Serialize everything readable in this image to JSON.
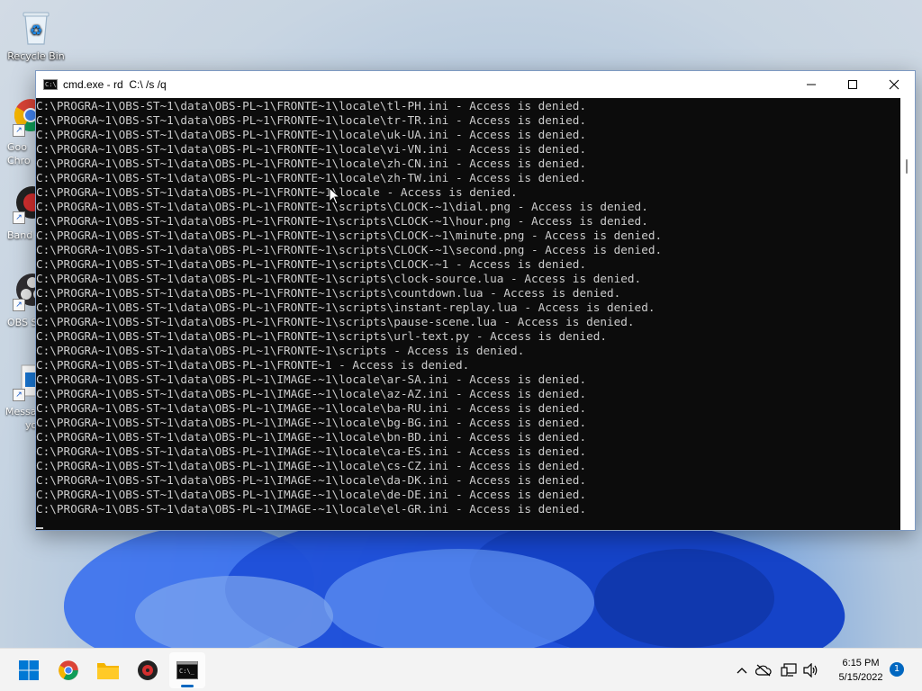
{
  "desktop": {
    "icons": [
      {
        "label": "Recycle Bin"
      }
    ],
    "partial_labels": [
      "Goo",
      "Chro",
      "Band",
      "OBS S",
      "Messa",
      "yo"
    ]
  },
  "window": {
    "title": "cmd.exe - rd  C:\\ /s /q",
    "minimize_icon": "minimize-icon",
    "maximize_icon": "maximize-icon",
    "close_icon": "close-icon",
    "console_lines": [
      "C:\\PROGRA~1\\OBS-ST~1\\data\\OBS-PL~1\\FRONTE~1\\locale\\tl-PH.ini - Access is denied.",
      "C:\\PROGRA~1\\OBS-ST~1\\data\\OBS-PL~1\\FRONTE~1\\locale\\tr-TR.ini - Access is denied.",
      "C:\\PROGRA~1\\OBS-ST~1\\data\\OBS-PL~1\\FRONTE~1\\locale\\uk-UA.ini - Access is denied.",
      "C:\\PROGRA~1\\OBS-ST~1\\data\\OBS-PL~1\\FRONTE~1\\locale\\vi-VN.ini - Access is denied.",
      "C:\\PROGRA~1\\OBS-ST~1\\data\\OBS-PL~1\\FRONTE~1\\locale\\zh-CN.ini - Access is denied.",
      "C:\\PROGRA~1\\OBS-ST~1\\data\\OBS-PL~1\\FRONTE~1\\locale\\zh-TW.ini - Access is denied.",
      "C:\\PROGRA~1\\OBS-ST~1\\data\\OBS-PL~1\\FRONTE~1\\locale - Access is denied.",
      "C:\\PROGRA~1\\OBS-ST~1\\data\\OBS-PL~1\\FRONTE~1\\scripts\\CLOCK-~1\\dial.png - Access is denied.",
      "C:\\PROGRA~1\\OBS-ST~1\\data\\OBS-PL~1\\FRONTE~1\\scripts\\CLOCK-~1\\hour.png - Access is denied.",
      "C:\\PROGRA~1\\OBS-ST~1\\data\\OBS-PL~1\\FRONTE~1\\scripts\\CLOCK-~1\\minute.png - Access is denied.",
      "C:\\PROGRA~1\\OBS-ST~1\\data\\OBS-PL~1\\FRONTE~1\\scripts\\CLOCK-~1\\second.png - Access is denied.",
      "C:\\PROGRA~1\\OBS-ST~1\\data\\OBS-PL~1\\FRONTE~1\\scripts\\CLOCK-~1 - Access is denied.",
      "C:\\PROGRA~1\\OBS-ST~1\\data\\OBS-PL~1\\FRONTE~1\\scripts\\clock-source.lua - Access is denied.",
      "C:\\PROGRA~1\\OBS-ST~1\\data\\OBS-PL~1\\FRONTE~1\\scripts\\countdown.lua - Access is denied.",
      "C:\\PROGRA~1\\OBS-ST~1\\data\\OBS-PL~1\\FRONTE~1\\scripts\\instant-replay.lua - Access is denied.",
      "C:\\PROGRA~1\\OBS-ST~1\\data\\OBS-PL~1\\FRONTE~1\\scripts\\pause-scene.lua - Access is denied.",
      "C:\\PROGRA~1\\OBS-ST~1\\data\\OBS-PL~1\\FRONTE~1\\scripts\\url-text.py - Access is denied.",
      "C:\\PROGRA~1\\OBS-ST~1\\data\\OBS-PL~1\\FRONTE~1\\scripts - Access is denied.",
      "C:\\PROGRA~1\\OBS-ST~1\\data\\OBS-PL~1\\FRONTE~1 - Access is denied.",
      "C:\\PROGRA~1\\OBS-ST~1\\data\\OBS-PL~1\\IMAGE-~1\\locale\\ar-SA.ini - Access is denied.",
      "C:\\PROGRA~1\\OBS-ST~1\\data\\OBS-PL~1\\IMAGE-~1\\locale\\az-AZ.ini - Access is denied.",
      "C:\\PROGRA~1\\OBS-ST~1\\data\\OBS-PL~1\\IMAGE-~1\\locale\\ba-RU.ini - Access is denied.",
      "C:\\PROGRA~1\\OBS-ST~1\\data\\OBS-PL~1\\IMAGE-~1\\locale\\bg-BG.ini - Access is denied.",
      "C:\\PROGRA~1\\OBS-ST~1\\data\\OBS-PL~1\\IMAGE-~1\\locale\\bn-BD.ini - Access is denied.",
      "C:\\PROGRA~1\\OBS-ST~1\\data\\OBS-PL~1\\IMAGE-~1\\locale\\ca-ES.ini - Access is denied.",
      "C:\\PROGRA~1\\OBS-ST~1\\data\\OBS-PL~1\\IMAGE-~1\\locale\\cs-CZ.ini - Access is denied.",
      "C:\\PROGRA~1\\OBS-ST~1\\data\\OBS-PL~1\\IMAGE-~1\\locale\\da-DK.ini - Access is denied.",
      "C:\\PROGRA~1\\OBS-ST~1\\data\\OBS-PL~1\\IMAGE-~1\\locale\\de-DE.ini - Access is denied.",
      "C:\\PROGRA~1\\OBS-ST~1\\data\\OBS-PL~1\\IMAGE-~1\\locale\\el-GR.ini - Access is denied."
    ]
  },
  "taskbar": {
    "buttons": [
      {
        "name": "start-button",
        "icon": "windows-logo-icon"
      },
      {
        "name": "chrome-taskbar-button",
        "icon": "chrome-icon"
      },
      {
        "name": "file-explorer-taskbar-button",
        "icon": "folder-icon"
      },
      {
        "name": "bandicam-taskbar-button",
        "icon": "bandicam-icon"
      },
      {
        "name": "cmd-taskbar-button",
        "icon": "cmd-icon",
        "active": true
      }
    ],
    "tray": {
      "icons": [
        "chevron-up-icon",
        "onedrive-offline-icon",
        "network-icon",
        "volume-icon"
      ],
      "time": "6:15 PM",
      "date": "5/15/2022",
      "notification_count": "1"
    }
  },
  "colors": {
    "console_bg": "#0c0c0c",
    "console_fg": "#cccccc",
    "accent": "#0067c0"
  }
}
